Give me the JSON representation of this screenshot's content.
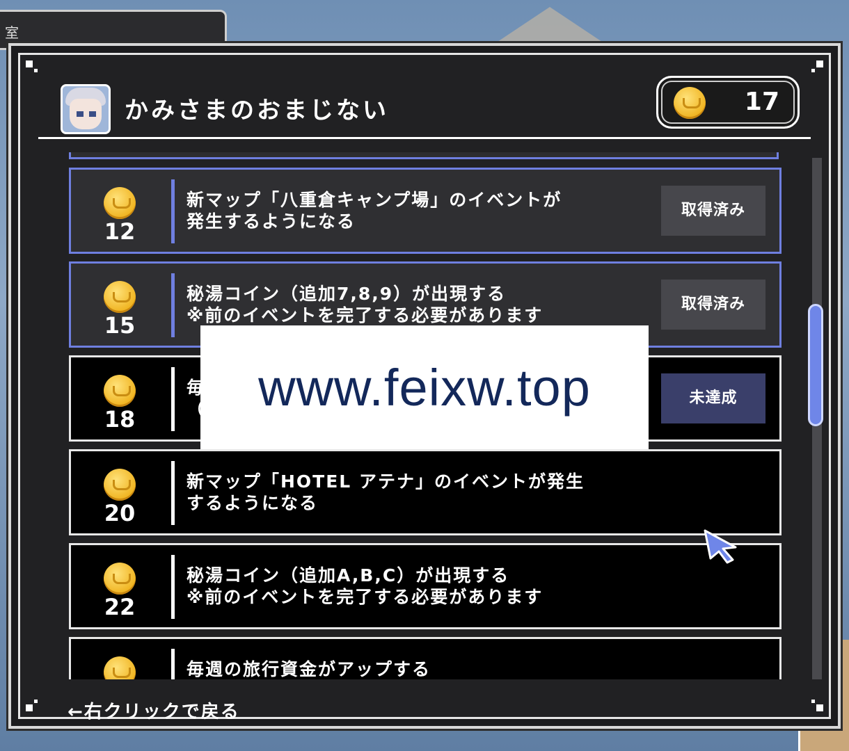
{
  "background": {
    "tab_text": "室"
  },
  "header": {
    "title": "かみさまのおまじない",
    "coin_count": "17"
  },
  "rewards": [
    {
      "cost": "12",
      "text": "新マップ「八重倉キャンプ場」のイベントが\n発生するようになる",
      "status": "取得済み",
      "state": "done"
    },
    {
      "cost": "15",
      "text": "秘湯コイン（追加7,8,9）が出現する\n※前のイベントを完了する必要があります",
      "status": "取得済み",
      "state": "done"
    },
    {
      "cost": "18",
      "text": "毎\n（",
      "status": "未達成",
      "state": "pending"
    },
    {
      "cost": "20",
      "text": "新マップ「HOTEL アテナ」のイベントが発生\nするようになる",
      "status": "",
      "state": "locked"
    },
    {
      "cost": "22",
      "text": "秘湯コイン（追加A,B,C）が出現する\n※前のイベントを完了する必要があります",
      "status": "",
      "state": "locked"
    },
    {
      "cost": "",
      "text": "毎週の旅行資金がアップする",
      "status": "",
      "state": "locked"
    }
  ],
  "footer": {
    "back_hint": "←右クリックで戻る"
  },
  "watermark": {
    "text": "www.feixw.top"
  },
  "colors": {
    "accent": "#6f7fe0",
    "coin": "#f0b421",
    "panel": "#212123"
  }
}
